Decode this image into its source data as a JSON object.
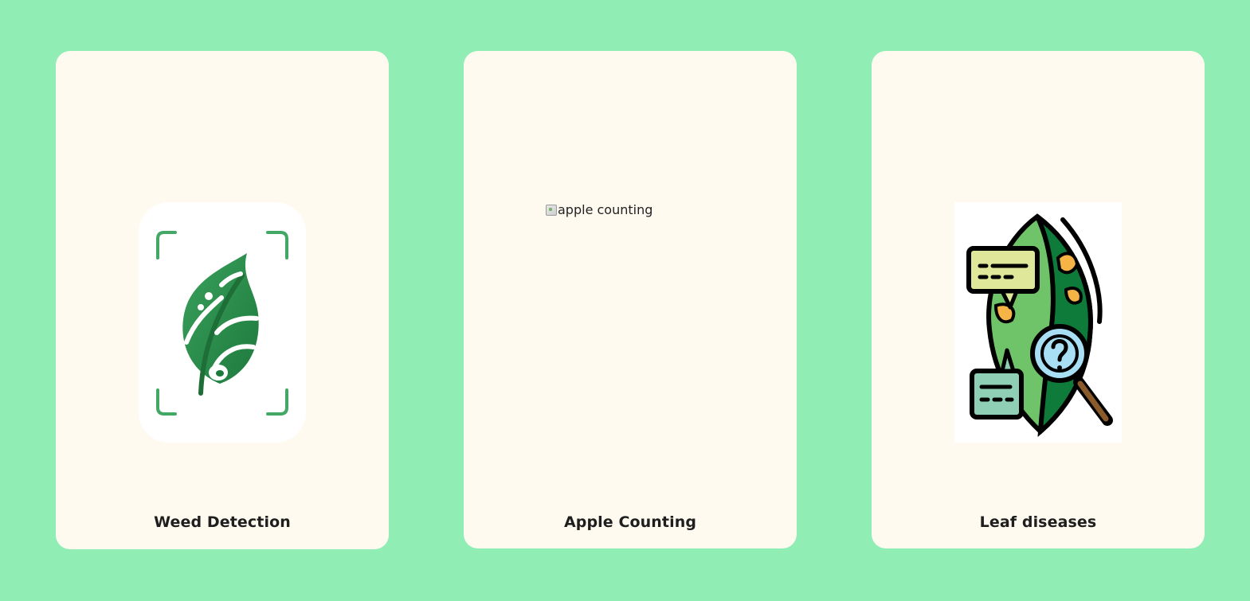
{
  "cards": [
    {
      "title": "Weed Detection",
      "image_icon": "leaf-scan-icon",
      "image_alt": ""
    },
    {
      "title": "Apple Counting",
      "image_icon": "broken-image-icon",
      "image_alt": "apple counting"
    },
    {
      "title": "Leaf diseases",
      "image_icon": "leaf-disease-search-icon",
      "image_alt": ""
    }
  ],
  "colors": {
    "background": "#90eeb4",
    "card": "#fffaf0",
    "title_text": "#1e1e1e"
  }
}
